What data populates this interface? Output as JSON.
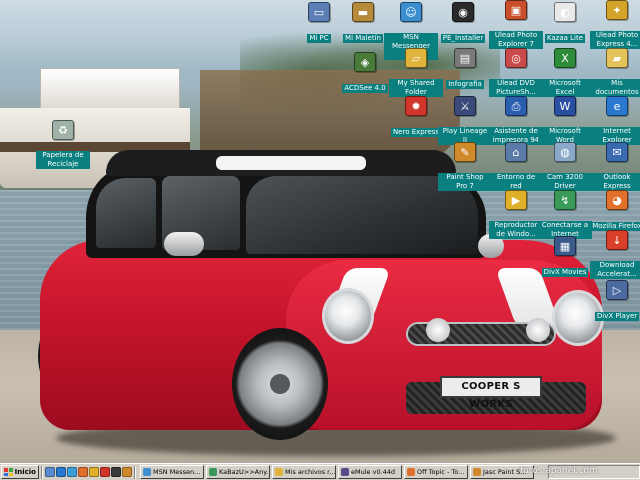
{
  "wallpaper": {
    "plate_text": "COOPER S WORKS"
  },
  "desktop_icons": [
    {
      "label": "Mi PC",
      "icon": "my-computer-icon",
      "color": "#5b7fb5"
    },
    {
      "label": "Mi Maletín",
      "icon": "briefcase-icon",
      "color": "#b58a3a"
    },
    {
      "label": "MSN Messenger 7.0",
      "icon": "msn-messenger-icon",
      "color": "#3a8fd0"
    },
    {
      "label": "PE_Installer",
      "icon": "installer-icon",
      "color": "#2a2a2a"
    },
    {
      "label": "Ulead Photo Explorer 7",
      "icon": "ulead-photo-icon",
      "color": "#c94f2a"
    },
    {
      "label": "Kazaa Lite",
      "icon": "kazaa-icon",
      "color": "#e9e9e9"
    },
    {
      "label": "Ulead Photo Express 4...",
      "icon": "ulead-express-icon",
      "color": "#d4a32a"
    },
    {
      "label": "ACDSee 4.0",
      "icon": "acdsee-icon",
      "color": "#4a7a3a"
    },
    {
      "label": "My Shared Folder",
      "icon": "shared-folder-icon",
      "color": "#e0b43a"
    },
    {
      "label": "Infografia",
      "icon": "infografia-icon",
      "color": "#7a7a7a"
    },
    {
      "label": "Ulead DVD PictureSh...",
      "icon": "ulead-dvd-icon",
      "color": "#c84a4a"
    },
    {
      "label": "Microsoft Excel",
      "icon": "excel-icon",
      "color": "#2e8b3a"
    },
    {
      "label": "Mis documentos",
      "icon": "my-documents-icon",
      "color": "#e3c35a"
    },
    {
      "label": "Papelera de Reciclaje",
      "icon": "recycle-bin-icon",
      "color": "#9fb2a8"
    },
    {
      "label": "Nero Express",
      "icon": "nero-icon",
      "color": "#d2362a"
    },
    {
      "label": "Play Lineage II",
      "icon": "lineage-icon",
      "color": "#3a4a7a"
    },
    {
      "label": "Asistente de impresora 94",
      "icon": "hp-printer-icon",
      "color": "#2a5fb0"
    },
    {
      "label": "Microsoft Word",
      "icon": "word-icon",
      "color": "#2a4fa0"
    },
    {
      "label": "Internet Explorer",
      "icon": "internet-explorer-icon",
      "color": "#2a78d0"
    },
    {
      "label": "Paint Shop Pro 7",
      "icon": "paint-shop-icon",
      "color": "#d08a2a"
    },
    {
      "label": "Entorno de red",
      "icon": "network-icon",
      "color": "#5a7aa8"
    },
    {
      "label": "Cam 3200 Driver",
      "icon": "webcam-icon",
      "color": "#8aa8c8"
    },
    {
      "label": "Outlook Express",
      "icon": "outlook-icon",
      "color": "#3a6ab0"
    },
    {
      "label": "Reproductor de Windo...",
      "icon": "media-player-icon",
      "color": "#e0b02a"
    },
    {
      "label": "Conectarse a Internet",
      "icon": "connect-internet-icon",
      "color": "#3a9a5a"
    },
    {
      "label": "Mozilla Firefox",
      "icon": "firefox-icon",
      "color": "#e0702a"
    },
    {
      "label": "DivX Movies",
      "icon": "divx-movies-icon",
      "color": "#3a5a8a"
    },
    {
      "label": "Download Accelerat...",
      "icon": "download-accelerator-icon",
      "color": "#d8402a"
    },
    {
      "label": "DivX Player",
      "icon": "divx-player-icon",
      "color": "#4a6aa0"
    }
  ],
  "taskbar": {
    "start_label": "Inicio",
    "quick_launch": [
      {
        "icon": "show-desktop-icon",
        "color": "#5a8ad0"
      },
      {
        "icon": "ie-quicklaunch-icon",
        "color": "#2a78d0"
      },
      {
        "icon": "messenger-quicklaunch-icon",
        "color": "#3aa0d8"
      },
      {
        "icon": "firefox-quicklaunch-icon",
        "color": "#e0702a"
      },
      {
        "icon": "media-quicklaunch-icon",
        "color": "#e0b02a"
      },
      {
        "icon": "nero-quicklaunch-icon",
        "color": "#d2362a"
      },
      {
        "icon": "winamp-quicklaunch-icon",
        "color": "#3a3a3a"
      },
      {
        "icon": "paint-quicklaunch-icon",
        "color": "#d08a2a"
      }
    ],
    "tasks": [
      {
        "label": "MSN Messen...",
        "icon": "msn-task-icon",
        "color": "#3a8fd0"
      },
      {
        "label": "KaBazU>>Any...",
        "icon": "chat-task-icon",
        "color": "#3a9a5a"
      },
      {
        "label": "Mis archivos r...",
        "icon": "folder-task-icon",
        "color": "#e0b43a"
      },
      {
        "label": "eMule v0.44d",
        "icon": "emule-task-icon",
        "color": "#5a4a8a"
      },
      {
        "label": "Off Topic - To...",
        "icon": "browser-task-icon",
        "color": "#e0702a"
      },
      {
        "label": "Jasc Paint S...",
        "icon": "paint-task-icon",
        "color": "#d08a2a"
      }
    ],
    "watermark": "fotos.apanel.com"
  }
}
